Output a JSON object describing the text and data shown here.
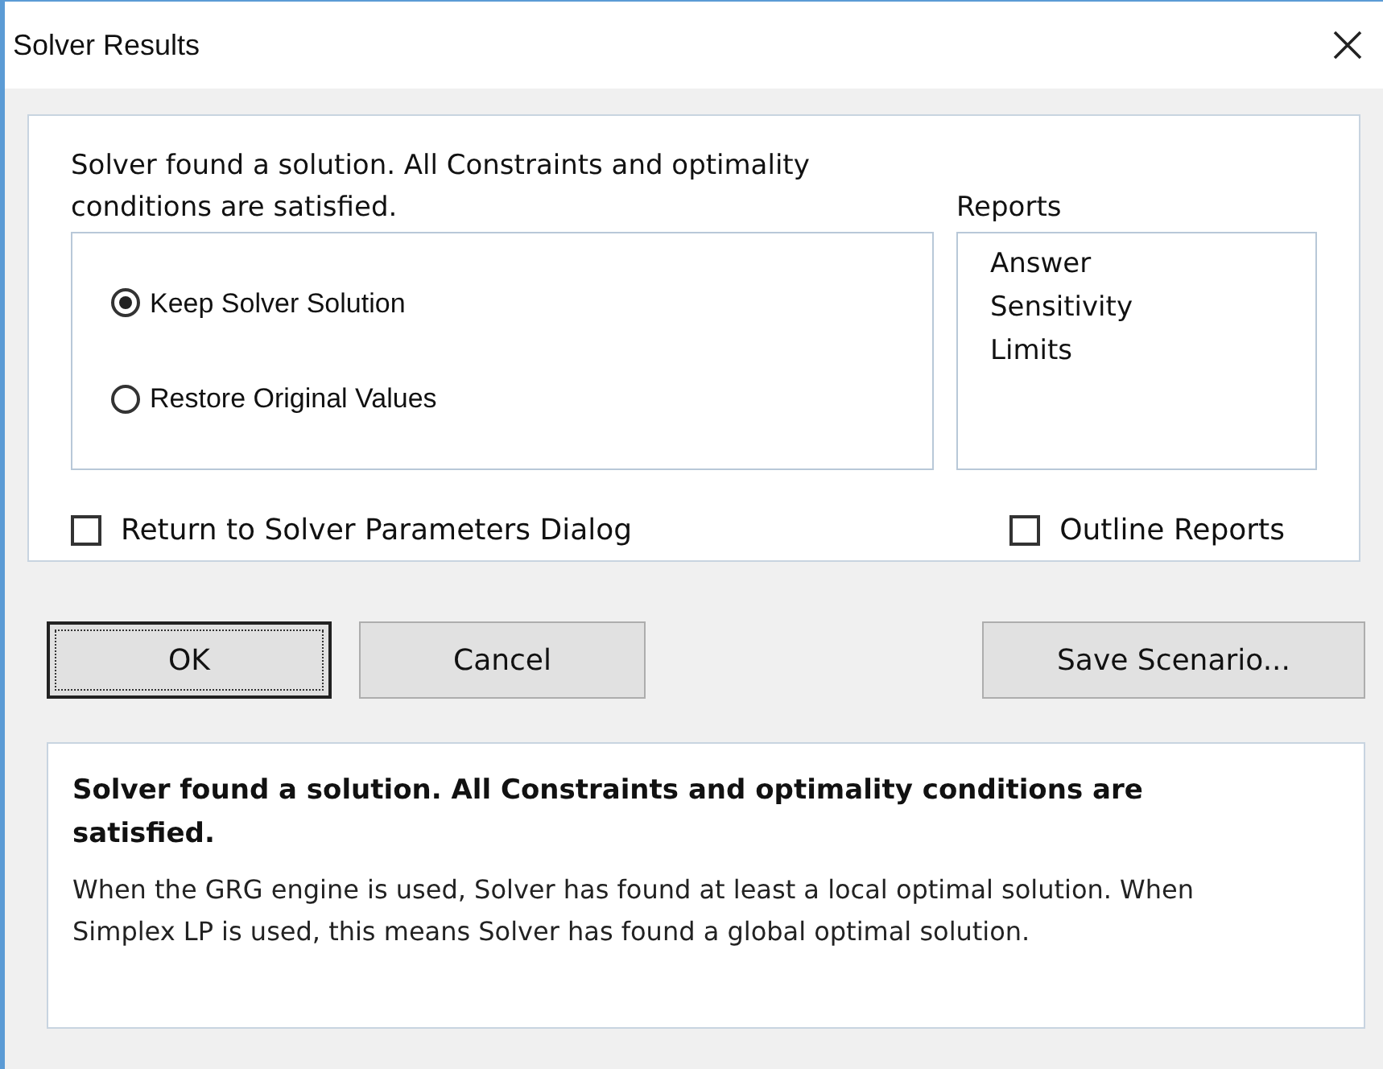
{
  "window": {
    "title": "Solver Results"
  },
  "status_message": "Solver found a solution.  All Constraints and optimality conditions are satisfied.",
  "options": [
    {
      "label": "Keep Solver Solution",
      "selected": true
    },
    {
      "label": "Restore Original Values",
      "selected": false
    }
  ],
  "reports": {
    "label": "Reports",
    "items": [
      "Answer",
      "Sensitivity",
      "Limits"
    ]
  },
  "return_checkbox": {
    "label": "Return to Solver Parameters Dialog",
    "checked": false
  },
  "outline_checkbox": {
    "label": "Outline Reports",
    "checked": false
  },
  "buttons": [
    {
      "label": "OK",
      "default": true
    },
    {
      "label": "Cancel",
      "default": false
    },
    {
      "label": "Save Scenario...",
      "default": false
    }
  ],
  "details": {
    "heading": "Solver found a solution.  All Constraints and optimality conditions are satisfied.",
    "body": "When the GRG engine is used, Solver has found at least a local optimal solution. When Simplex LP is used, this means Solver has found a global optimal solution."
  }
}
